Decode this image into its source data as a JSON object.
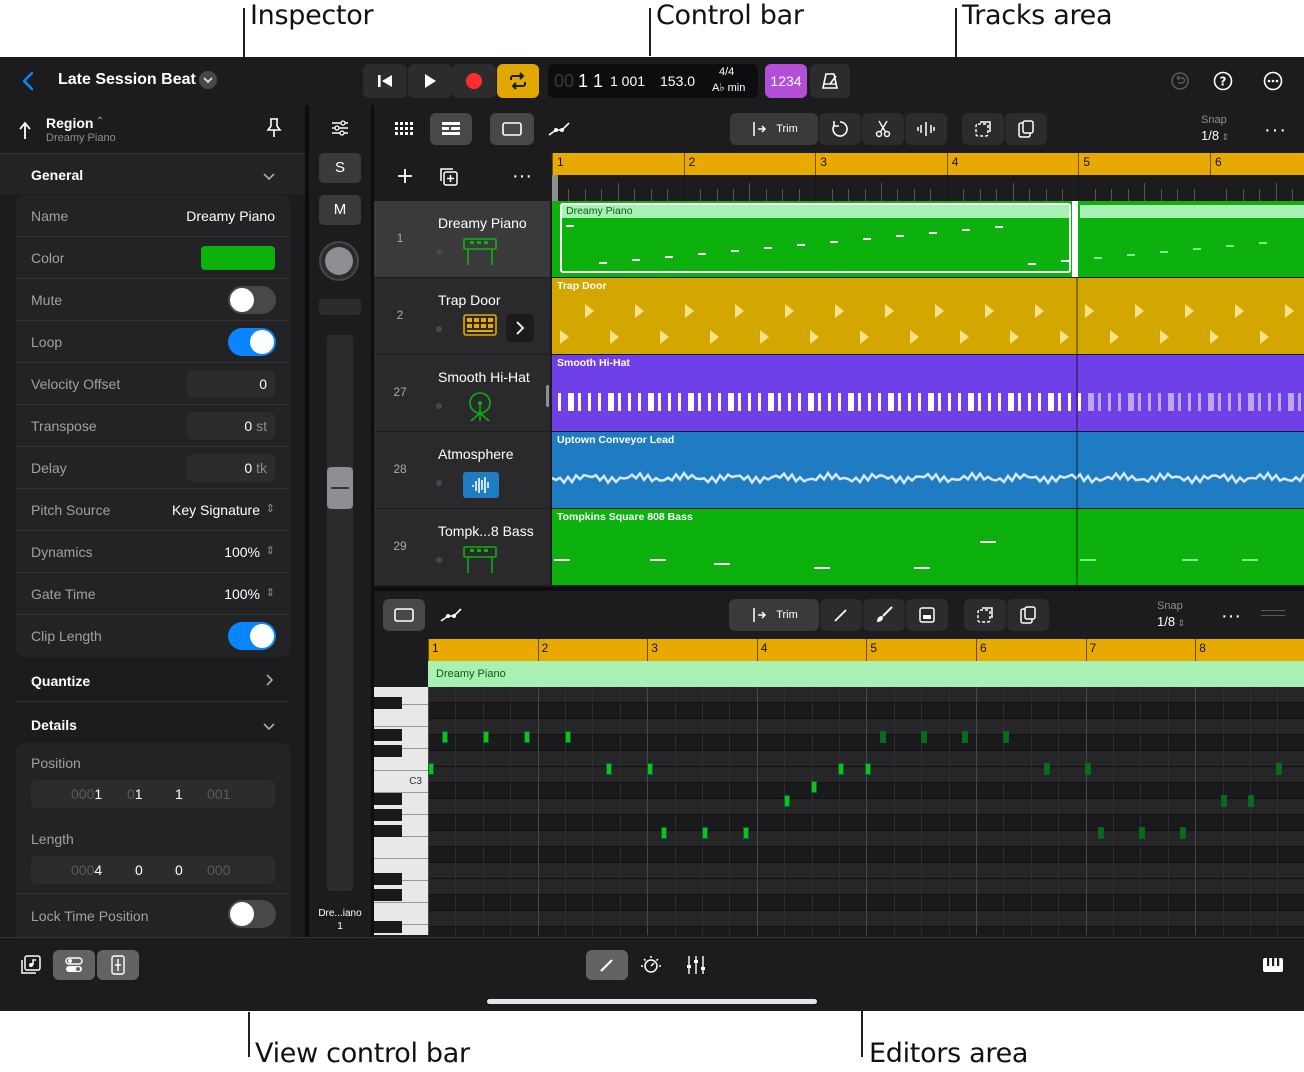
{
  "callouts": {
    "inspector": "Inspector",
    "control_bar": "Control bar",
    "tracks_area": "Tracks area",
    "view_control_bar": "View control bar",
    "editors_area": "Editors area"
  },
  "project": {
    "title": "Late Session Beat"
  },
  "lcd": {
    "position_dim": "00",
    "position": "1 1",
    "position_ticks": "1 001",
    "tempo": "153.0",
    "signature": "4/4",
    "key": "A♭ min",
    "count_in": "1234"
  },
  "inspector": {
    "header_title": "Region",
    "header_subtitle": "Dreamy Piano",
    "general_title": "General",
    "rows": [
      {
        "label": "Name",
        "value": "Dreamy Piano"
      },
      {
        "label": "Color"
      },
      {
        "label": "Mute"
      },
      {
        "label": "Loop"
      },
      {
        "label": "Velocity Offset",
        "value": "0"
      },
      {
        "label": "Transpose",
        "value": "0",
        "unit": "st"
      },
      {
        "label": "Delay",
        "value": "0",
        "unit": "tk"
      },
      {
        "label": "Pitch Source",
        "value": "Key Signature"
      },
      {
        "label": "Dynamics",
        "value": "100%"
      },
      {
        "label": "Gate Time",
        "value": "100%"
      },
      {
        "label": "Clip Length"
      }
    ],
    "quantize_title": "Quantize",
    "details_title": "Details",
    "position_label": "Position",
    "position_fields": [
      {
        "dim": "000",
        "val": "1"
      },
      {
        "dim": "0",
        "val": "1"
      },
      {
        "dim": "",
        "val": "1"
      },
      {
        "dim": "",
        "val": "001"
      }
    ],
    "length_label": "Length",
    "length_fields": [
      {
        "dim": "000",
        "val": "4"
      },
      {
        "dim": "",
        "val": "0"
      },
      {
        "dim": "",
        "val": "0"
      },
      {
        "dim": "",
        "val": "000"
      }
    ],
    "lock_label": "Lock Time Position"
  },
  "channel_strip": {
    "solo": "S",
    "mute": "M",
    "name": "Dre...iano",
    "number": "1"
  },
  "tracks_toolbar": {
    "trim_label": "Trim",
    "snap_label": "Snap",
    "snap_value": "1/8"
  },
  "ruler": [
    "1",
    "2",
    "3",
    "4",
    "5",
    "6"
  ],
  "tracks": [
    {
      "number": "1",
      "name": "Dreamy Piano",
      "region": "Dreamy Piano",
      "color": "#0db10d"
    },
    {
      "number": "2",
      "name": "Trap Door",
      "region": "Trap Door",
      "color": "#d4a600"
    },
    {
      "number": "27",
      "name": "Smooth Hi-Hat",
      "region": "Smooth Hi-Hat",
      "color": "#6f3fe8"
    },
    {
      "number": "28",
      "name": "Atmosphere",
      "region": "Uptown Conveyor Lead",
      "color": "#1f7bc2"
    },
    {
      "number": "29",
      "name": "Tompk...8 Bass",
      "region": "Tompkins Square 808 Bass",
      "color": "#0db10d"
    }
  ],
  "editor_toolbar": {
    "trim_label": "Trim",
    "snap_label": "Snap",
    "snap_value": "1/8"
  },
  "editor_ruler": [
    "1",
    "2",
    "3",
    "4",
    "5",
    "6",
    "7",
    "8"
  ],
  "editor_region": "Dreamy Piano",
  "piano_c3": "C3",
  "colors": {
    "accent": "#0a84ff",
    "record": "#ff2d2d",
    "cycle": "#e0a800",
    "count_in": "#b34fd6",
    "ruler": "#e8a900",
    "region_green": "#0db10d"
  }
}
